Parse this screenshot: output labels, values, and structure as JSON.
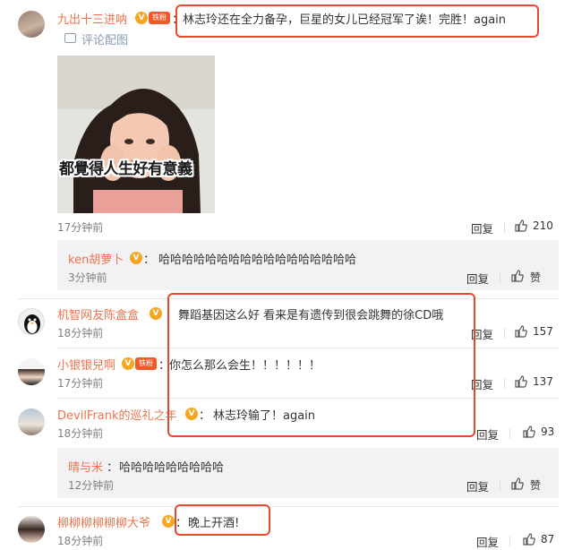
{
  "comments": [
    {
      "user": "九出十三进呐",
      "badge": "铁粉",
      "text": "林志玲还在全力备孕，巨星的女儿已经冠军了诶！完胜！again",
      "attach_label": "评论配图",
      "image_caption": "都覺得人生好有意義",
      "time": "17分钟前",
      "reply": "回复",
      "likes": "210"
    },
    {
      "user": "ken胡萝卜",
      "text": "哈哈哈哈哈哈哈哈哈哈哈哈哈哈哈哈哈",
      "time": "3分钟前",
      "reply": "回复",
      "likes": "赞"
    },
    {
      "user": "机智网友陈盒盒",
      "text": "舞蹈基因这么好 看来是有遗传到很会跳舞的徐CD哦",
      "time": "18分钟前",
      "reply": "回复",
      "likes": "157"
    },
    {
      "user": "小银银兒啊",
      "badge": "铁粉",
      "text": "你怎么那么会生！！！！！！",
      "time": "17分钟前",
      "reply": "回复",
      "likes": "137"
    },
    {
      "user": "DevilFrank的巡礼之年",
      "text": "林志玲输了！again",
      "time": "18分钟前",
      "reply": "回复",
      "likes": "93"
    },
    {
      "user": "晴与米",
      "text": "哈哈哈哈哈哈哈哈哈",
      "time": "12分钟前",
      "reply": "回复",
      "likes": "赞"
    },
    {
      "user": "柳柳柳柳柳柳大爷",
      "text": "晚上开酒!",
      "time": "18分钟前",
      "reply": "回复",
      "likes": "87"
    }
  ],
  "colors": {
    "username": "#eb7350",
    "highlight_box": "#e8492c",
    "reply_bg": "#f2f2f5"
  }
}
